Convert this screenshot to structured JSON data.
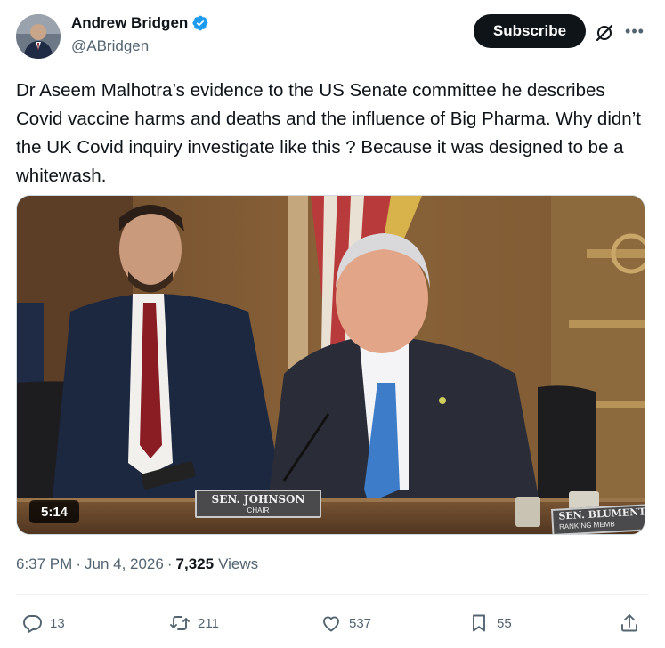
{
  "author": {
    "display_name": "Andrew Bridgen",
    "handle": "@ABridgen",
    "verified": true
  },
  "header": {
    "subscribe_label": "Subscribe",
    "grok_icon": "grok-icon",
    "more_icon": "more-dots-icon"
  },
  "tweet": {
    "text": "Dr Aseem Malhotra’s evidence to the US Senate committee he describes Covid vaccine harms and deaths and the influence of Big Pharma. Why didn’t the UK Covid inquiry investigate like this ? Because it was designed to be a whitewash."
  },
  "media": {
    "duration": "5:14",
    "nameplate_main": "SEN. JOHNSON",
    "nameplate_sub": "CHAIR",
    "nameplate2_main": "SEN. BLUMENTH",
    "nameplate2_sub": "RANKING MEMB"
  },
  "meta": {
    "time": "6:37 PM",
    "separator": "·",
    "date": "Jun 4, 2026",
    "views_count": "7,325",
    "views_label": "Views"
  },
  "actions": {
    "replies": "13",
    "reposts": "211",
    "likes": "537",
    "bookmarks": "55"
  },
  "colors": {
    "accent": "#1d9bf0",
    "text_primary": "#0f1419",
    "text_secondary": "#536471"
  }
}
